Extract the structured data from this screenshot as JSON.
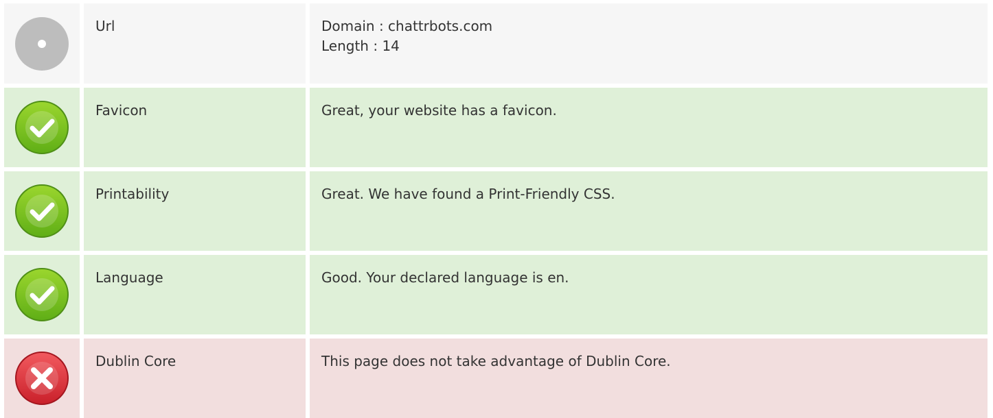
{
  "colors": {
    "neutral_bg": "#f6f6f6",
    "pass_bg": "#dff0d8",
    "fail_bg": "#f2dede",
    "pass_icon": "#7cc51f",
    "fail_icon": "#e3343a",
    "neutral_icon": "#bdbdbd"
  },
  "rows": [
    {
      "status": "neutral",
      "icon": "info-dot-icon",
      "label": "Url",
      "lines": [
        "Domain : chattrbots.com",
        "Length : 14"
      ]
    },
    {
      "status": "pass",
      "icon": "check-icon",
      "label": "Favicon",
      "lines": [
        "Great, your website has a favicon."
      ]
    },
    {
      "status": "pass",
      "icon": "check-icon",
      "label": "Printability",
      "lines": [
        "Great. We have found a Print-Friendly CSS."
      ]
    },
    {
      "status": "pass",
      "icon": "check-icon",
      "label": "Language",
      "lines": [
        "Good. Your declared language is en."
      ]
    },
    {
      "status": "fail",
      "icon": "cross-icon",
      "label": "Dublin Core",
      "lines": [
        "This page does not take advantage of Dublin Core."
      ]
    }
  ]
}
